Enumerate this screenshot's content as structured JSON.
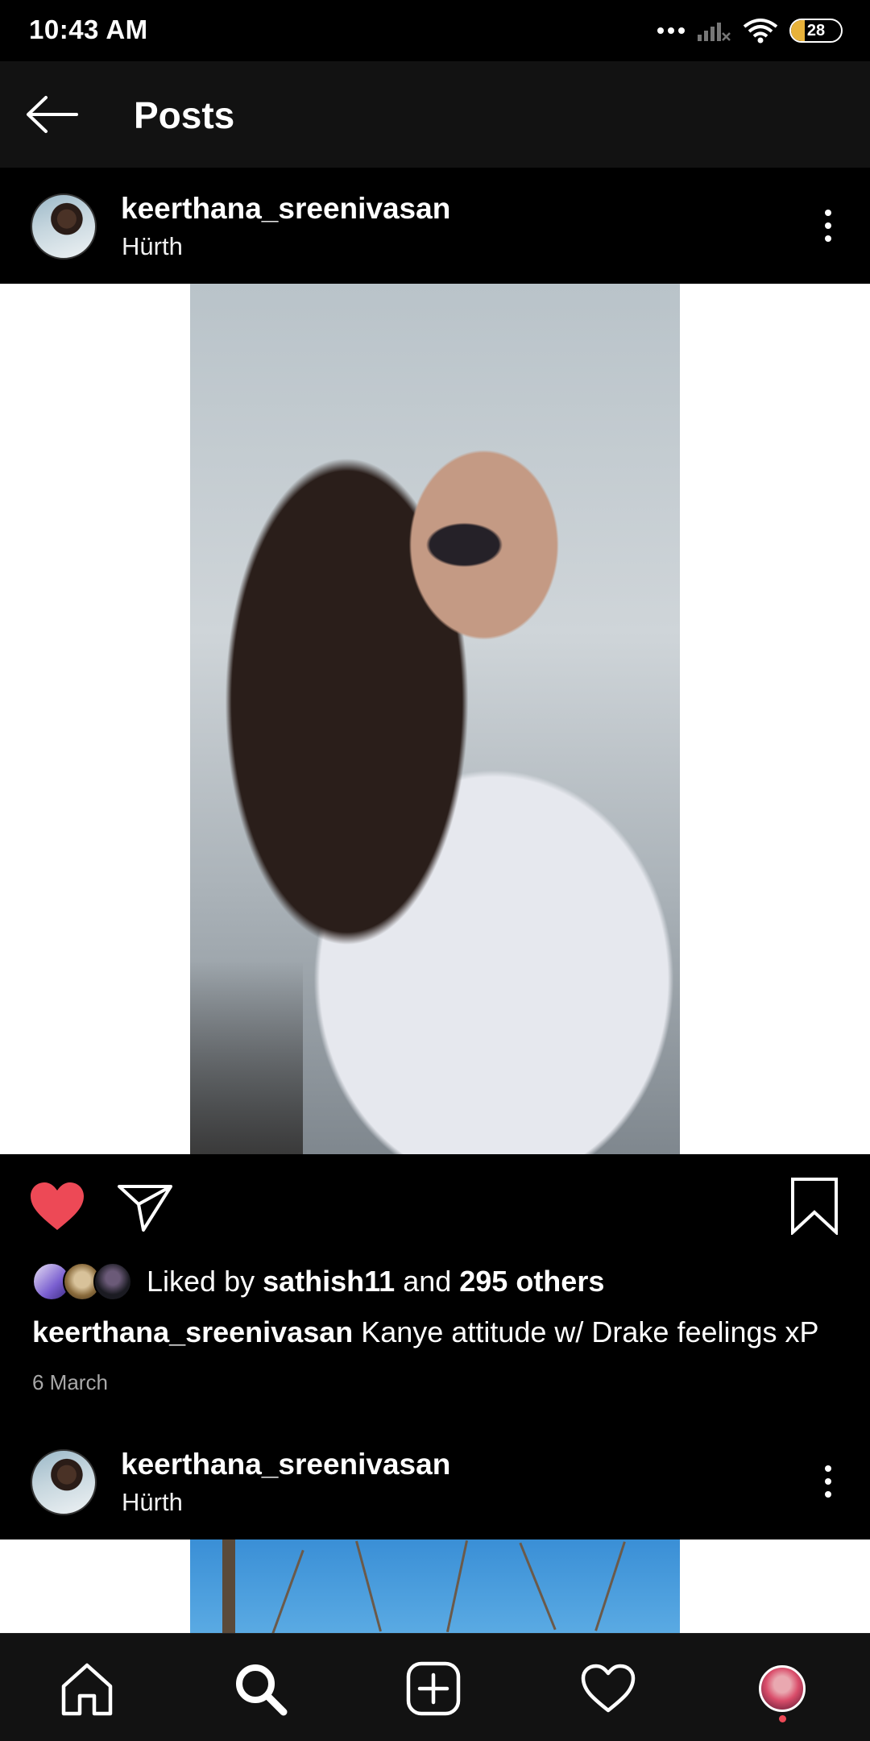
{
  "status_bar": {
    "time": "10:43 AM",
    "battery": "28",
    "battery_level": 0.28
  },
  "header": {
    "title": "Posts",
    "back_icon": "arrow-left-icon"
  },
  "posts": [
    {
      "username": "keerthana_sreenivasan",
      "location": "Hürth",
      "liked": true,
      "likes": {
        "prefix": "Liked by ",
        "user": "sathish11",
        "mid": " and ",
        "others": "295 others"
      },
      "caption_user": "keerthana_sreenivasan",
      "caption_text": " Kanye attitude w/ Drake feelings xP",
      "date": "6 March"
    },
    {
      "username": "keerthana_sreenivasan",
      "location": "Hürth"
    }
  ],
  "icons": {
    "like": "heart-filled-icon",
    "share": "paper-plane-icon",
    "save": "bookmark-icon",
    "more": "more-vertical-icon"
  },
  "nav": [
    {
      "name": "home",
      "icon": "home-icon"
    },
    {
      "name": "search",
      "icon": "search-icon"
    },
    {
      "name": "new-post",
      "icon": "add-square-icon"
    },
    {
      "name": "activity",
      "icon": "heart-icon"
    },
    {
      "name": "profile",
      "icon": "avatar"
    }
  ],
  "colors": {
    "like": "#ed4956",
    "background": "#000000",
    "header": "#121212",
    "battery": "#e8b23a"
  }
}
